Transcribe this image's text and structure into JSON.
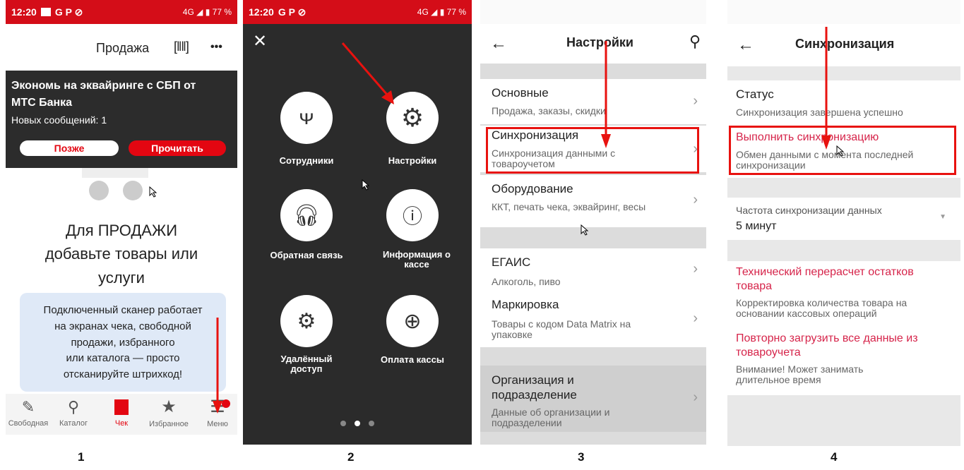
{
  "status": {
    "time": "12:20",
    "signal": "4G",
    "battery": "77 %"
  },
  "p1": {
    "title": "Продажа",
    "more": "•••",
    "promo": {
      "title": "Экономь на эквайринге с СБП от МТС Банка",
      "messages": "Новых сообщений: 1",
      "later": "Позже",
      "read": "Прочитать"
    },
    "empty": {
      "line1": "Для ПРОДАЖИ",
      "line2": "добавьте товары или",
      "line3": "услуги"
    },
    "tip": {
      "l1": "Подключенный сканер работает",
      "l2": "на экранах чека, свободной",
      "l3": "продажи, избранного",
      "l4": "или каталога — просто",
      "l5": "отсканируйте штрихкод!"
    },
    "nav": [
      "Свободная",
      "Каталог",
      "Чек",
      "Избранное",
      "Меню"
    ]
  },
  "p2": {
    "items": [
      "Сотрудники",
      "Настройки",
      "Обратная связь",
      "Информация о кассе",
      "Удалённый доступ",
      "Оплата кассы"
    ]
  },
  "p3": {
    "title": "Настройки",
    "rows": [
      {
        "title": "Основные",
        "sub": "Продажа, заказы, скидки"
      },
      {
        "title": "Синхронизация",
        "sub": "Синхронизация данными с товароучетом"
      },
      {
        "title": "Оборудование",
        "sub": "ККТ, печать чека, эквайринг, весы"
      },
      {
        "title": "ЕГАИС",
        "sub": "Алкоголь, пиво"
      },
      {
        "title": "Маркировка",
        "sub": "Товары с кодом Data Matrix на упаковке"
      },
      {
        "title": "Организация и подразделение",
        "sub": "Данные об организации и подразделении"
      }
    ]
  },
  "p4": {
    "title": "Синхронизация",
    "status_label": "Статус",
    "status_value": "Синхронизация завершена успешно",
    "sync_title": "Выполнить синхронизацию",
    "sync_sub": "Обмен данными с момента последней синхронизации",
    "freq_label": "Частота синхронизации данных",
    "freq_value": "5 минут",
    "recalc_title": "Технический перерасчет остатков товара",
    "recalc_sub": "Корректировка количества товара на основании кассовых операций",
    "reload_title": "Повторно загрузить все данные из товароучета",
    "reload_sub": "Внимание! Может занимать длительное время"
  },
  "captions": [
    "1",
    "2",
    "3",
    "4"
  ],
  "colors": {
    "mts_red": "#e30611",
    "dark_menu": "#2b2b2b",
    "alert_red": "#d6244a"
  }
}
